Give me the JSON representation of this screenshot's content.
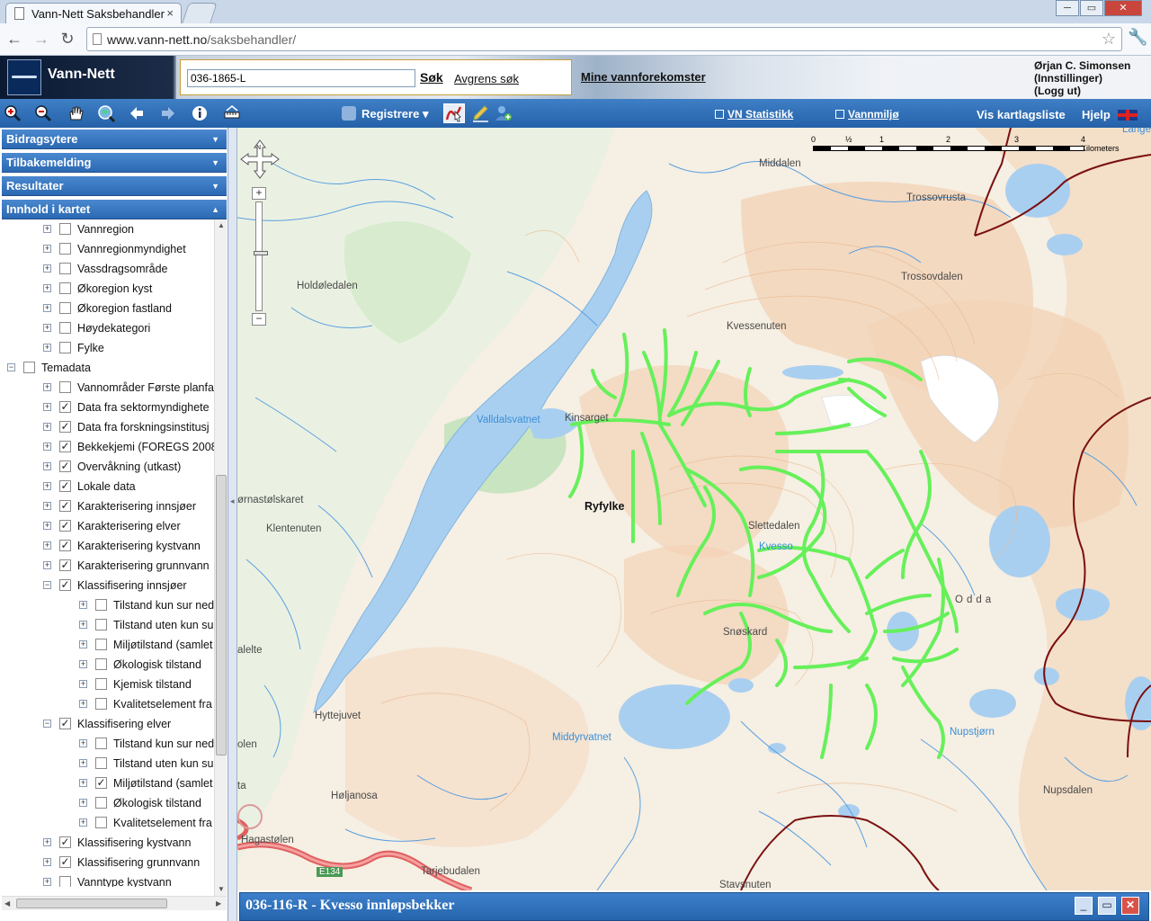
{
  "browser": {
    "tab_title": "Vann-Nett Saksbehandler",
    "tab_close": "×",
    "url_host": "www.vann-nett.no",
    "url_path": "/saksbehandler/",
    "controls": {
      "minimize": "─",
      "maximize": "▭",
      "close": "✕"
    },
    "nav": {
      "back": "←",
      "forward": "→",
      "reload": "↻",
      "star": "☆",
      "wrench": "🔧"
    }
  },
  "header": {
    "app_title": "Vann-Nett",
    "search_value": "036-1865-L",
    "search_button": "Søk",
    "refine_link": "Avgrens søk",
    "my_waters_link": "Mine vannforekomster",
    "user_name": "Ørjan C. Simonsen",
    "user_settings": "(Innstillinger)",
    "user_logout": "(Logg ut)"
  },
  "toolbar": {
    "register_label": "Registrere",
    "register_caret": "▾",
    "links": {
      "statistics": "VN Statistikk",
      "water_env": "Vannmiljø",
      "layer_list": "Vis kartlagsliste",
      "help": "Hjelp"
    },
    "icons": [
      "zoom-in-icon",
      "zoom-out-icon",
      "pan-hand-icon",
      "zoom-extent-icon",
      "back-arrow-icon",
      "forward-arrow-icon",
      "info-icon",
      "measure-icon"
    ]
  },
  "sidebar": {
    "panels": [
      {
        "label": "Bidragsytere",
        "arrow": "▼"
      },
      {
        "label": "Tilbakemelding",
        "arrow": "▼"
      },
      {
        "label": "Resultater",
        "arrow": "▼"
      },
      {
        "label": "Innhold i kartet",
        "arrow": "▲"
      }
    ],
    "tree": [
      {
        "label": "Vannregion",
        "level": 1,
        "exp": "+",
        "checked": ""
      },
      {
        "label": "Vannregionmyndighet",
        "level": 1,
        "exp": "+",
        "checked": ""
      },
      {
        "label": "Vassdragsområde",
        "level": 1,
        "exp": "+",
        "checked": ""
      },
      {
        "label": "Økoregion kyst",
        "level": 1,
        "exp": "+",
        "checked": ""
      },
      {
        "label": "Økoregion fastland",
        "level": 1,
        "exp": "+",
        "checked": ""
      },
      {
        "label": "Høydekategori",
        "level": 1,
        "exp": "+",
        "checked": ""
      },
      {
        "label": "Fylke",
        "level": 1,
        "exp": "+",
        "checked": ""
      },
      {
        "label": "Temadata",
        "level": 0,
        "exp": "−",
        "checked": ""
      },
      {
        "label": "Vannområder Første planfa",
        "level": 1,
        "exp": "+",
        "checked": ""
      },
      {
        "label": "Data fra sektormyndighete",
        "level": 1,
        "exp": "+",
        "checked": "✓"
      },
      {
        "label": "Data fra forskningsinstitusj",
        "level": 1,
        "exp": "+",
        "checked": "✓"
      },
      {
        "label": "Bekkekjemi (FOREGS 2008",
        "level": 1,
        "exp": "+",
        "checked": "✓"
      },
      {
        "label": "Overvåkning (utkast)",
        "level": 1,
        "exp": "+",
        "checked": "✓"
      },
      {
        "label": "Lokale data",
        "level": 1,
        "exp": "+",
        "checked": "✓"
      },
      {
        "label": "Karakterisering innsjøer",
        "level": 1,
        "exp": "+",
        "checked": "✓"
      },
      {
        "label": "Karakterisering elver",
        "level": 1,
        "exp": "+",
        "checked": "✓"
      },
      {
        "label": "Karakterisering kystvann",
        "level": 1,
        "exp": "+",
        "checked": "✓"
      },
      {
        "label": "Karakterisering grunnvann",
        "level": 1,
        "exp": "+",
        "checked": "✓"
      },
      {
        "label": "Klassifisering innsjøer",
        "level": 1,
        "exp": "−",
        "checked": "✓"
      },
      {
        "label": "Tilstand kun sur ned",
        "level": 2,
        "exp": "+",
        "checked": ""
      },
      {
        "label": "Tilstand uten kun su",
        "level": 2,
        "exp": "+",
        "checked": ""
      },
      {
        "label": "Miljøtilstand (samlet",
        "level": 2,
        "exp": "+",
        "checked": ""
      },
      {
        "label": "Økologisk tilstand",
        "level": 2,
        "exp": "+",
        "checked": ""
      },
      {
        "label": "Kjemisk tilstand",
        "level": 2,
        "exp": "+",
        "checked": ""
      },
      {
        "label": "Kvalitetselement fra",
        "level": 2,
        "exp": "+",
        "checked": ""
      },
      {
        "label": "Klassifisering elver",
        "level": 1,
        "exp": "−",
        "checked": "✓"
      },
      {
        "label": "Tilstand kun sur ned",
        "level": 2,
        "exp": "+",
        "checked": ""
      },
      {
        "label": "Tilstand uten kun su",
        "level": 2,
        "exp": "+",
        "checked": ""
      },
      {
        "label": "Miljøtilstand (samlet",
        "level": 2,
        "exp": "+",
        "checked": "✓"
      },
      {
        "label": "Økologisk tilstand",
        "level": 2,
        "exp": "+",
        "checked": ""
      },
      {
        "label": "Kvalitetselement fra",
        "level": 2,
        "exp": "+",
        "checked": ""
      },
      {
        "label": "Klassifisering kystvann",
        "level": 1,
        "exp": "+",
        "checked": "✓"
      },
      {
        "label": "Klassifisering grunnvann",
        "level": 1,
        "exp": "+",
        "checked": "✓"
      },
      {
        "label": "Vanntype kystvann",
        "level": 1,
        "exp": "+",
        "checked": ""
      }
    ]
  },
  "map": {
    "scale_labels": [
      "0",
      "½",
      "1",
      "2",
      "3",
      "4 Kilometers"
    ],
    "places": [
      {
        "name": "Middalen",
        "kind": ""
      },
      {
        "name": "Trossovrusta",
        "kind": ""
      },
      {
        "name": "Trossovdalen",
        "kind": ""
      },
      {
        "name": "Holdøledalen",
        "kind": ""
      },
      {
        "name": "Kvessenuten",
        "kind": ""
      },
      {
        "name": "Valldalsvatnet",
        "kind": "water"
      },
      {
        "name": "Kinsarget",
        "kind": ""
      },
      {
        "name": "Ryfylke",
        "kind": "bold"
      },
      {
        "name": "ørnastølskaret",
        "kind": ""
      },
      {
        "name": "Klentenuten",
        "kind": ""
      },
      {
        "name": "Slettedalen",
        "kind": ""
      },
      {
        "name": "Kvesso",
        "kind": "water"
      },
      {
        "name": "Snøskard",
        "kind": ""
      },
      {
        "name": "Odda",
        "kind": ""
      },
      {
        "name": "alelte",
        "kind": ""
      },
      {
        "name": "Hyttejuvet",
        "kind": ""
      },
      {
        "name": "Middyrvatnet",
        "kind": "water"
      },
      {
        "name": "Nupstjørn",
        "kind": "water"
      },
      {
        "name": "olen",
        "kind": ""
      },
      {
        "name": "Høljanosa",
        "kind": ""
      },
      {
        "name": "Nupsdalen",
        "kind": ""
      },
      {
        "name": "Hagastølen",
        "kind": ""
      },
      {
        "name": "E134",
        "kind": "road"
      },
      {
        "name": "Tarjebudalen",
        "kind": ""
      },
      {
        "name": "Stavsnuten",
        "kind": ""
      },
      {
        "name": "Lange",
        "kind": "water"
      },
      {
        "name": "ta",
        "kind": ""
      }
    ],
    "colors": {
      "river_highlight": "#66f05a",
      "water": "#a9cff0",
      "border": "#7a1010"
    }
  },
  "info_window": {
    "title": "036-116-R - Kvesso innløpsbekker",
    "minimize": "_",
    "maximize": "▭",
    "close": "✕"
  }
}
